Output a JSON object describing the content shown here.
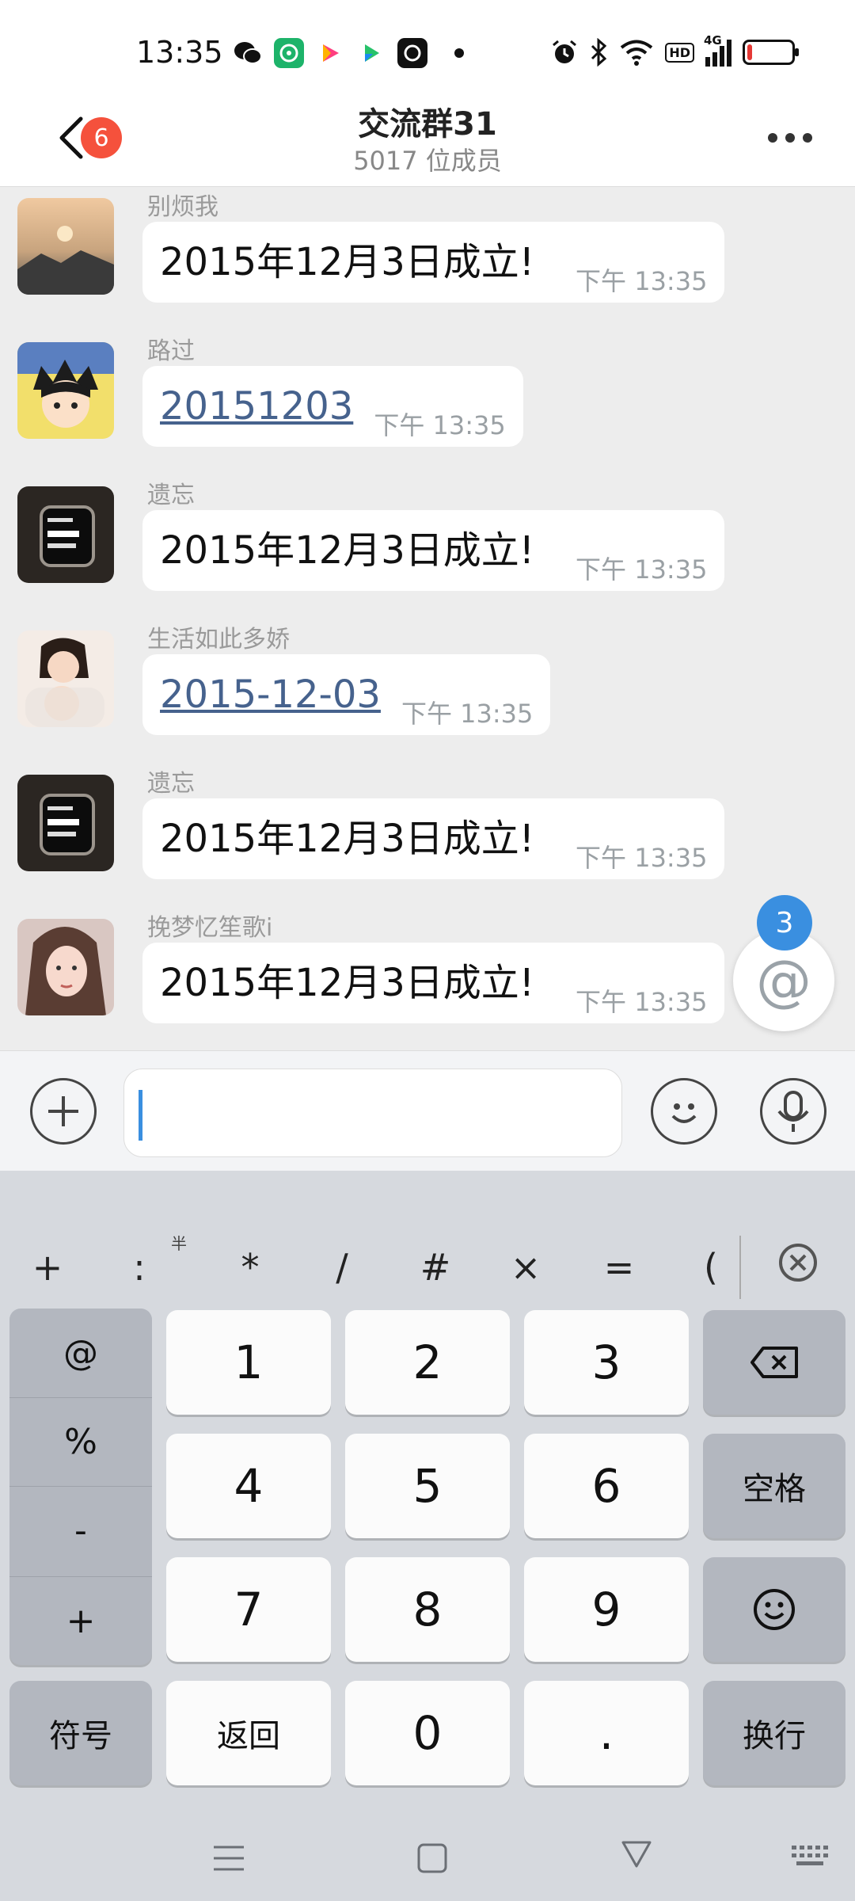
{
  "status_bar": {
    "time": "13:35",
    "app_icons": [
      "wechat-icon",
      "app-green-icon",
      "app-pink-icon",
      "app-play-icon",
      "app-black-icon"
    ],
    "right_icons": [
      "alarm-icon",
      "bluetooth-icon",
      "wifi-icon",
      "hd-icon",
      "signal-4g-icon",
      "battery-icon"
    ],
    "hd_label": "HD",
    "network_label": "4G",
    "battery_level": 0.1
  },
  "header": {
    "back_badge": "6",
    "title": "交流群31",
    "subtitle": "5017 位成员"
  },
  "messages": [
    {
      "sender": "别烦我",
      "text": "2015年12月3日成立!",
      "time": "下午 13:35",
      "is_link": false
    },
    {
      "sender": "路过",
      "text": "20151203",
      "time": "下午 13:35",
      "is_link": true
    },
    {
      "sender": "遗忘",
      "text": "2015年12月3日成立!",
      "time": "下午 13:35",
      "is_link": false
    },
    {
      "sender": "生活如此多娇",
      "text": "2015-12-03",
      "time": "下午 13:35",
      "is_link": true
    },
    {
      "sender": "遗忘",
      "text": "2015年12月3日成立!",
      "time": "下午 13:35",
      "is_link": false
    },
    {
      "sender": "挽梦忆笙歌i",
      "text": "2015年12月3日成立!",
      "time": "下午 13:35",
      "is_link": false
    }
  ],
  "mention": {
    "count": "3",
    "symbol": "@"
  },
  "keyboard": {
    "symbol_row": [
      "+",
      ":",
      "*",
      "/",
      "#",
      "×",
      "=",
      "("
    ],
    "half_width_mark": "半",
    "side_symbols": [
      "@",
      "%",
      "-",
      "+"
    ],
    "digits": [
      "1",
      "2",
      "3",
      "4",
      "5",
      "6",
      "7",
      "8",
      "9",
      "0"
    ],
    "dot": ".",
    "space_label": "空格",
    "symbols_label": "符号",
    "back_label": "返回",
    "enter_label": "换行"
  },
  "colors": {
    "accent_blue": "#3a8fe0",
    "badge_red": "#f5513c",
    "link_blue": "#46628d",
    "chat_bg": "#ededed",
    "keyboard_bg": "#d6d9de"
  }
}
